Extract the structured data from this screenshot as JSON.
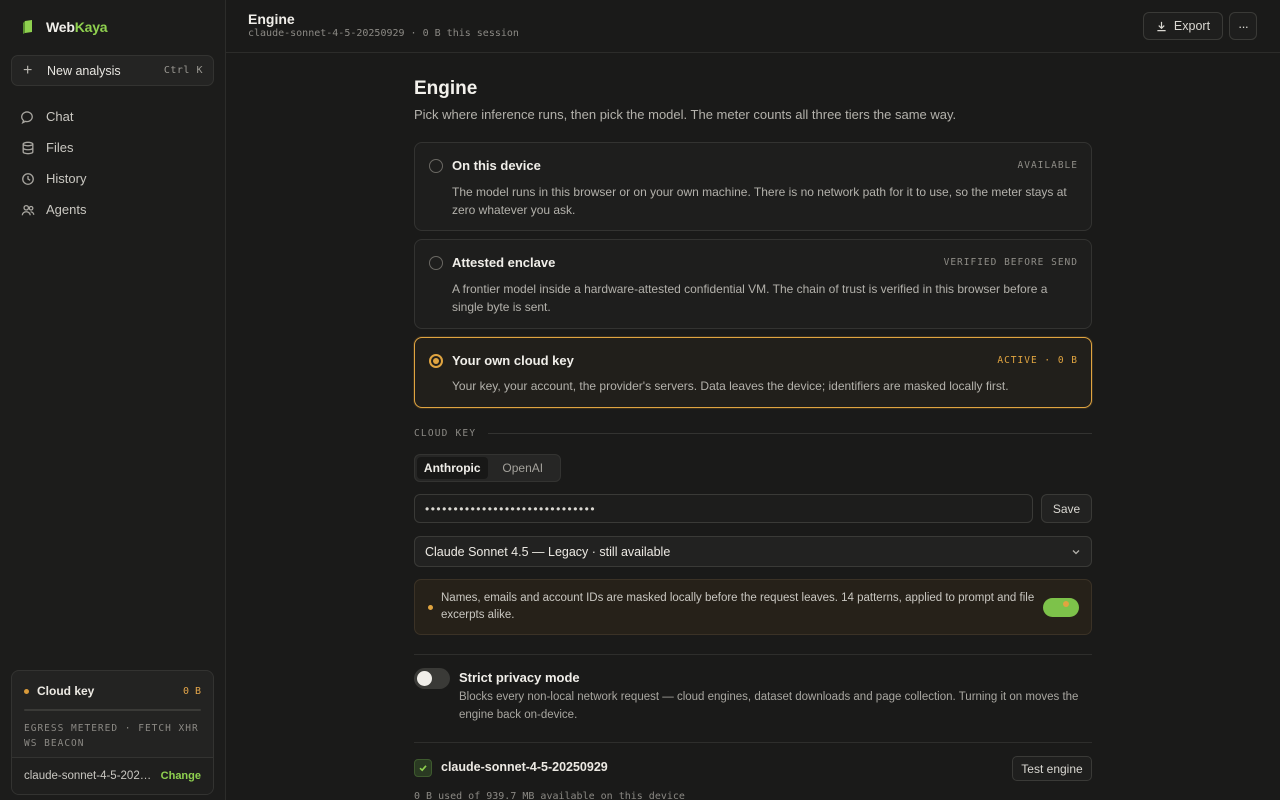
{
  "brand": {
    "part1": "Web",
    "part2": "Kaya"
  },
  "sidebar": {
    "new_analysis": {
      "label": "New analysis",
      "shortcut": "Ctrl K"
    },
    "items": [
      {
        "label": "Chat",
        "icon": "chat-icon"
      },
      {
        "label": "Files",
        "icon": "database-icon"
      },
      {
        "label": "History",
        "icon": "clock-icon"
      },
      {
        "label": "Agents",
        "icon": "users-icon"
      }
    ],
    "cloud_card": {
      "title": "Cloud key",
      "bytes": "0 B",
      "meter_fraction": 0,
      "egress": "EGRESS METERED · FETCH XHR WS BEACON",
      "model": "claude-sonnet-4-5-202…",
      "change_label": "Change"
    }
  },
  "topbar": {
    "title": "Engine",
    "subtitle": "claude-sonnet-4-5-20250929 · 0 B this session",
    "export_label": "Export",
    "more_label": "···"
  },
  "main": {
    "heading": "Engine",
    "subtitle": "Pick where inference runs, then pick the model. The meter counts all three tiers the same way.",
    "options": [
      {
        "title": "On this device",
        "tag": "AVAILABLE",
        "desc": "The model runs in this browser or on your own machine. There is no network path for it to use, so the meter stays at zero whatever you ask.",
        "selected": false
      },
      {
        "title": "Attested enclave",
        "tag": "VERIFIED BEFORE SEND",
        "desc": "A frontier model inside a hardware-attested confidential VM. The chain of trust is verified in this browser before a single byte is sent.",
        "selected": false
      },
      {
        "title": "Your own cloud key",
        "tag": "ACTIVE · 0 B",
        "desc": "Your key, your account, the provider's servers. Data leaves the device; identifiers are masked locally first.",
        "selected": true
      }
    ],
    "cloud_key_label": "CLOUD KEY",
    "providers": [
      {
        "label": "Anthropic",
        "selected": true
      },
      {
        "label": "OpenAI",
        "selected": false
      }
    ],
    "key_value": "••••••••••••••••••••••••••••••",
    "save_label": "Save",
    "model_select": "Claude Sonnet 4.5 — Legacy · still available",
    "mask_notice": "Names, emails and account IDs are masked locally before the request leaves. 14 patterns, applied to prompt and file excerpts alike.",
    "strict": {
      "title": "Strict privacy mode",
      "desc": "Blocks every non-local network request — cloud engines, dataset downloads and page collection. Turning it on moves the engine back on-device.",
      "enabled": false
    },
    "model_id": "claude-sonnet-4-5-20250929",
    "test_label": "Test engine",
    "usage": "0 B used of 939.7 MB available on this device"
  },
  "colors": {
    "accent": "#e0a440",
    "brand_green": "#8fd14f",
    "background": "#1a1a19"
  }
}
